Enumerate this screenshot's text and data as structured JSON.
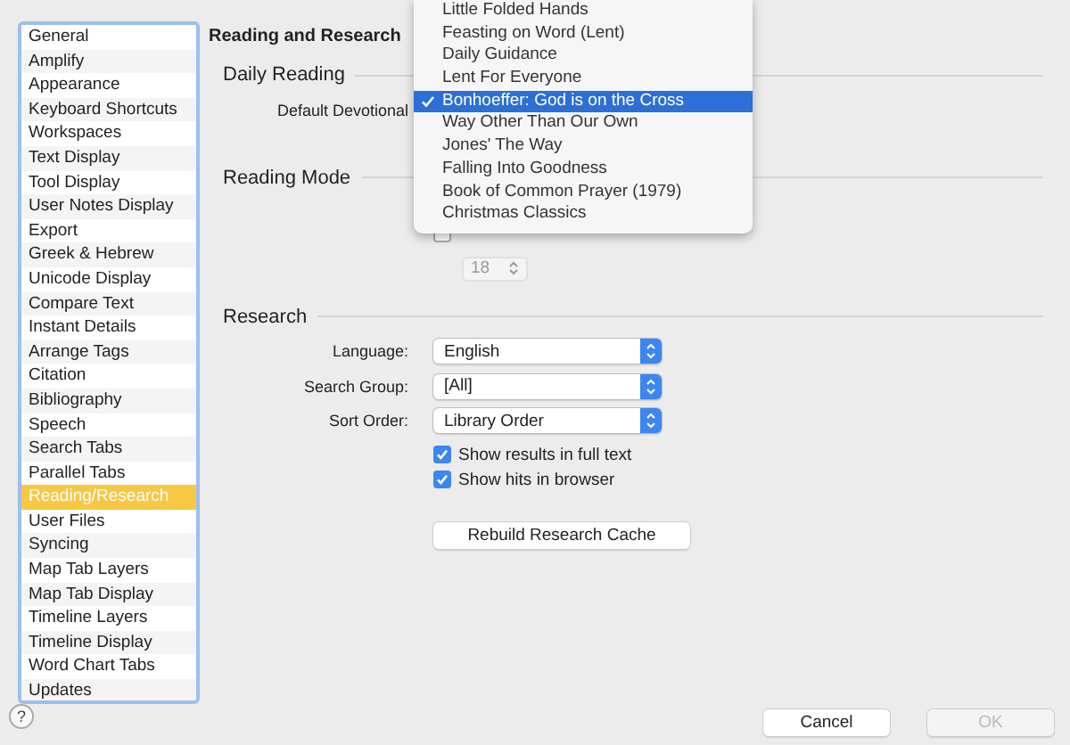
{
  "sidebar": {
    "items": [
      {
        "label": "General",
        "selected": false
      },
      {
        "label": "Amplify",
        "selected": false
      },
      {
        "label": "Appearance",
        "selected": false
      },
      {
        "label": "Keyboard Shortcuts",
        "selected": false
      },
      {
        "label": "Workspaces",
        "selected": false
      },
      {
        "label": "Text Display",
        "selected": false
      },
      {
        "label": "Tool Display",
        "selected": false
      },
      {
        "label": "User Notes Display",
        "selected": false
      },
      {
        "label": "Export",
        "selected": false
      },
      {
        "label": "Greek & Hebrew",
        "selected": false
      },
      {
        "label": "Unicode Display",
        "selected": false
      },
      {
        "label": "Compare Text",
        "selected": false
      },
      {
        "label": "Instant Details",
        "selected": false
      },
      {
        "label": "Arrange Tags",
        "selected": false
      },
      {
        "label": "Citation",
        "selected": false
      },
      {
        "label": "Bibliography",
        "selected": false
      },
      {
        "label": "Speech",
        "selected": false
      },
      {
        "label": "Search Tabs",
        "selected": false
      },
      {
        "label": "Parallel Tabs",
        "selected": false
      },
      {
        "label": "Reading/Research",
        "selected": true
      },
      {
        "label": "User Files",
        "selected": false
      },
      {
        "label": "Syncing",
        "selected": false
      },
      {
        "label": "Map Tab Layers",
        "selected": false
      },
      {
        "label": "Map Tab Display",
        "selected": false
      },
      {
        "label": "Timeline Layers",
        "selected": false
      },
      {
        "label": "Timeline Display",
        "selected": false
      },
      {
        "label": "Word Chart Tabs",
        "selected": false
      },
      {
        "label": "Updates",
        "selected": false
      }
    ]
  },
  "help": "?",
  "title": "Reading and Research",
  "daily_reading": {
    "heading": "Daily Reading",
    "devotional_label": "Default Devotional"
  },
  "reading_mode": {
    "heading": "Reading Mode",
    "font_size_checkbox": {
      "checked": false
    },
    "font_size": "18"
  },
  "research": {
    "heading": "Research",
    "popups": [
      {
        "label": "Language:",
        "value": "English"
      },
      {
        "label": "Search Group:",
        "value": "[All]"
      },
      {
        "label": "Sort Order:",
        "value": "Library Order"
      }
    ],
    "checkboxes": [
      {
        "label": "Show results in full text",
        "checked": true
      },
      {
        "label": "Show hits in browser",
        "checked": true
      }
    ],
    "rebuild_button": "Rebuild Research Cache"
  },
  "devotional_menu": {
    "items": [
      {
        "label": "Little Folded Hands",
        "selected": false
      },
      {
        "label": "Feasting on Word (Lent)",
        "selected": false
      },
      {
        "label": "Daily Guidance",
        "selected": false
      },
      {
        "label": "Lent For Everyone",
        "selected": false
      },
      {
        "label": "Bonhoeffer: God is on the Cross",
        "selected": true
      },
      {
        "label": "Way Other Than Our Own",
        "selected": false
      },
      {
        "label": "Jones' The Way",
        "selected": false
      },
      {
        "label": "Falling Into Goodness",
        "selected": false
      },
      {
        "label": "Book of Common Prayer (1979)",
        "selected": false
      },
      {
        "label": "Christmas Classics",
        "selected": false
      }
    ]
  },
  "buttons": [
    {
      "label": "Cancel",
      "disabled": false
    },
    {
      "label": "OK",
      "disabled": true
    }
  ]
}
